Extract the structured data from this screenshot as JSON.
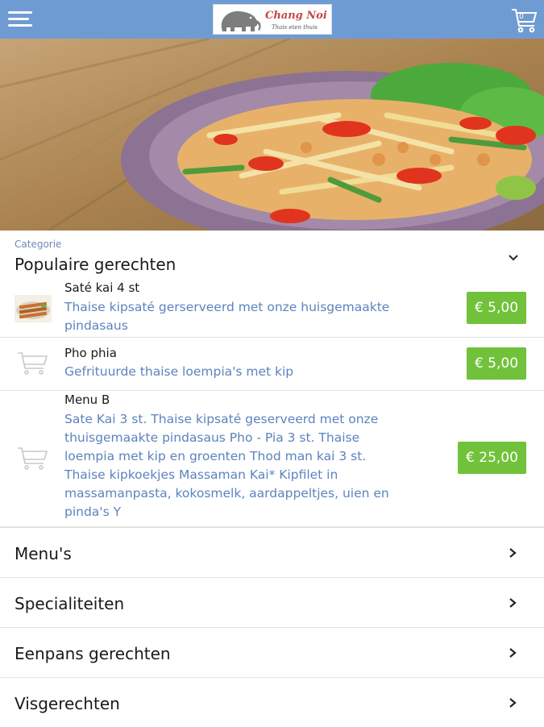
{
  "header": {
    "logo_name": "Chang Noi",
    "logo_tagline": "Thais eten thuis",
    "cart_count": "0",
    "colors": {
      "bar": "#6f9bd3",
      "price": "#71c23a",
      "link": "#5c83bd"
    },
    "icons": {
      "menu": "hamburger-menu-icon",
      "cart": "shopping-cart-icon"
    }
  },
  "category": {
    "caption": "Categorie",
    "title": "Populaire gerechten"
  },
  "items": [
    {
      "name": "Saté kai 4 st",
      "desc_lines": [
        "Thaise kipsaté gerserveerd met onze huisgemaakte",
        "pindasaus"
      ],
      "price": "€ 5,00"
    },
    {
      "name": "Pho phia",
      "desc_lines": [
        "Gefrituurde thaise loempia's met kip"
      ],
      "price": "€ 5,00"
    },
    {
      "name": "Menu B",
      "desc_lines": [
        "Sate Kai 3 st. Thaise kipsaté geserveerd met onze",
        "thuisgemaakte pindasaus Pho - Pia 3 st. Thaise",
        "loempia met kip en groenten Thod man kai 3 st.",
        "Thaise kipkoekjes Massaman Kai* Kipfilet in",
        "massamanpasta, kokosmelk, aardappeltjes, uien en",
        "pinda's Y"
      ],
      "price": "€ 25,00"
    }
  ],
  "categories": [
    {
      "label": "Menu's"
    },
    {
      "label": "Specialiteiten"
    },
    {
      "label": "Eenpans gerechten"
    },
    {
      "label": "Visgerechten"
    }
  ]
}
